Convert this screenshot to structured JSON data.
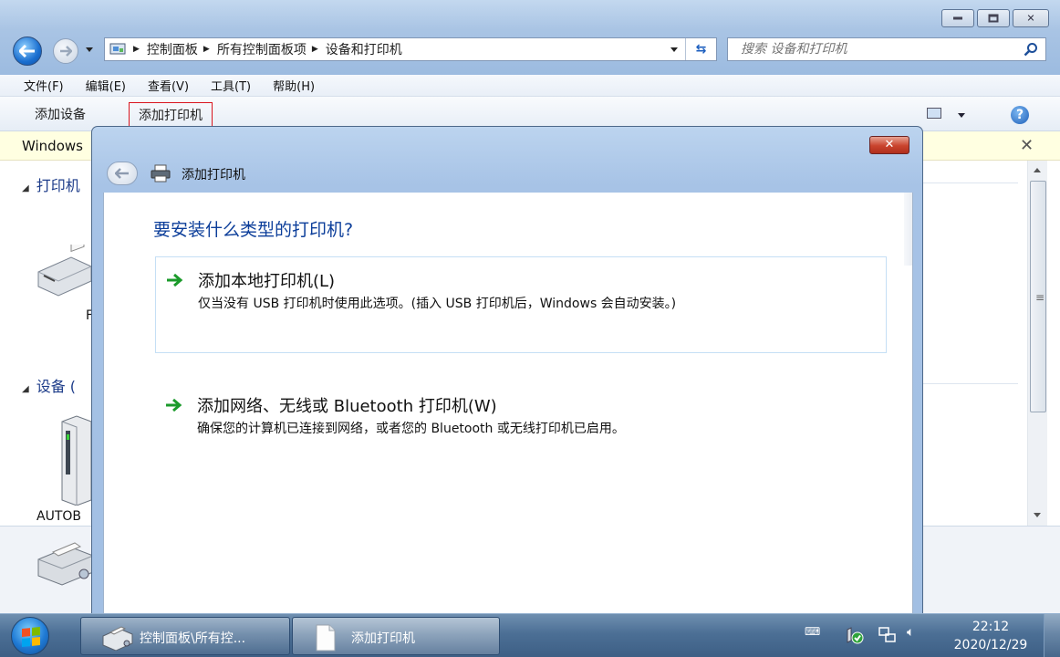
{
  "explorer": {
    "address": {
      "crumbs": [
        "控制面板",
        "所有控制面板项",
        "设备和打印机"
      ]
    },
    "search": {
      "placeholder": "搜索 设备和打印机"
    },
    "menu": [
      "文件(F)",
      "编辑(E)",
      "查看(V)",
      "工具(T)",
      "帮助(H)"
    ],
    "commands": {
      "add_device": "添加设备",
      "add_printer": "添加打印机"
    },
    "infobar_text": "Windows",
    "groups": {
      "printers": "打印机",
      "devices": "设备 ("
    },
    "device_labels": {
      "fax": "F",
      "autob": "AUTOB"
    }
  },
  "dialog": {
    "title": "添加打印机",
    "heading": "要安装什么类型的打印机?",
    "options": [
      {
        "title": "添加本地打印机(L)",
        "desc": "仅当没有 USB 打印机时使用此选项。(插入 USB 打印机后，Windows 会自动安装。)"
      },
      {
        "title": "添加网络、无线或 Bluetooth 打印机(W)",
        "desc": "确保您的计算机已连接到网络，或者您的 Bluetooth 或无线打印机已启用。"
      }
    ]
  },
  "taskbar": {
    "items": [
      "控制面板\\所有控...",
      "添加打印机"
    ],
    "time": "22:12",
    "date": "2020/12/29"
  },
  "colors": {
    "accent_red": "#d9151e",
    "heading_blue": "#0c3e9a",
    "green_arrow": "#1a9a2a"
  }
}
